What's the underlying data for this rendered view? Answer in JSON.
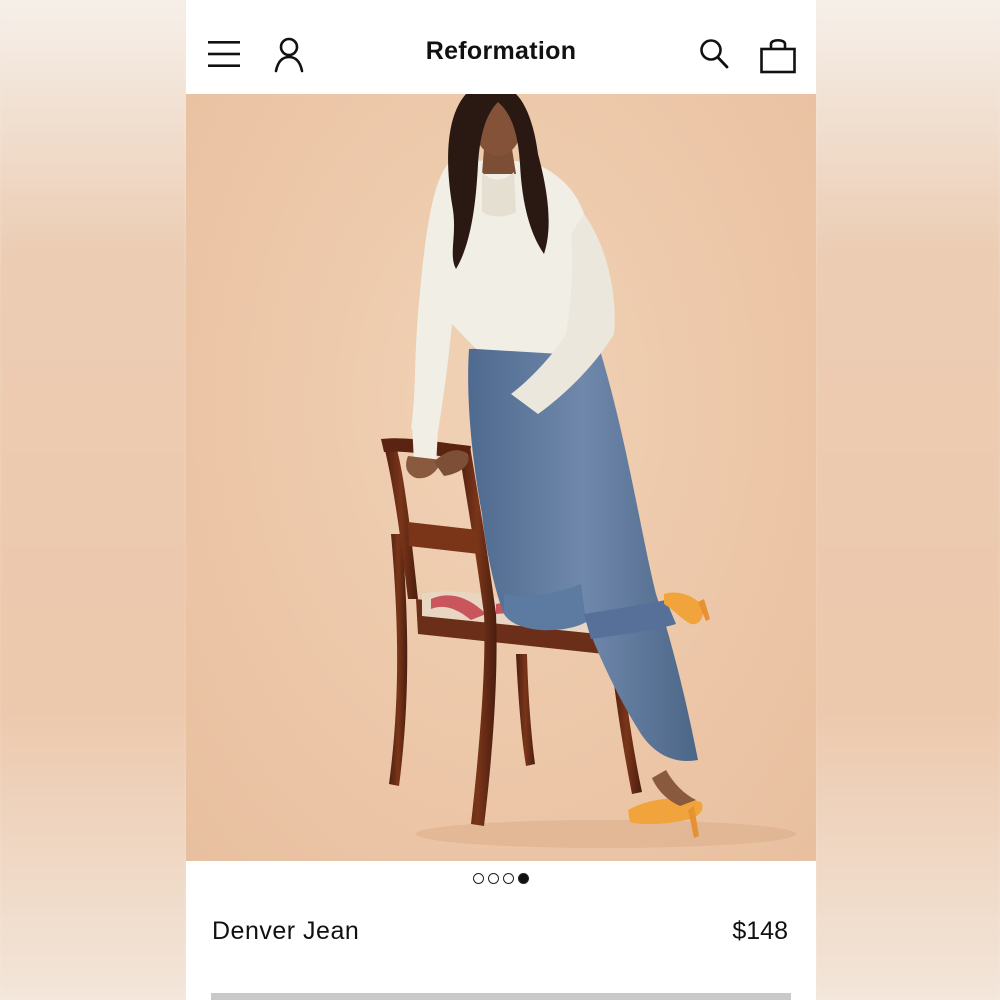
{
  "header": {
    "brand": "Reformation",
    "icons": [
      "hamburger-menu-icon",
      "account-icon",
      "search-icon",
      "shopping-bag-icon"
    ]
  },
  "carousel": {
    "total_slides": 4,
    "active_slide": 4
  },
  "product": {
    "name": "Denver Jean",
    "price": "$148"
  },
  "colors": {
    "background": "#ecc6a7",
    "text": "#111111",
    "blouse": "#f1eee6",
    "jeans": "#5a7397",
    "chair_wood": "#6b2e19",
    "heels": "#f1a43c"
  }
}
